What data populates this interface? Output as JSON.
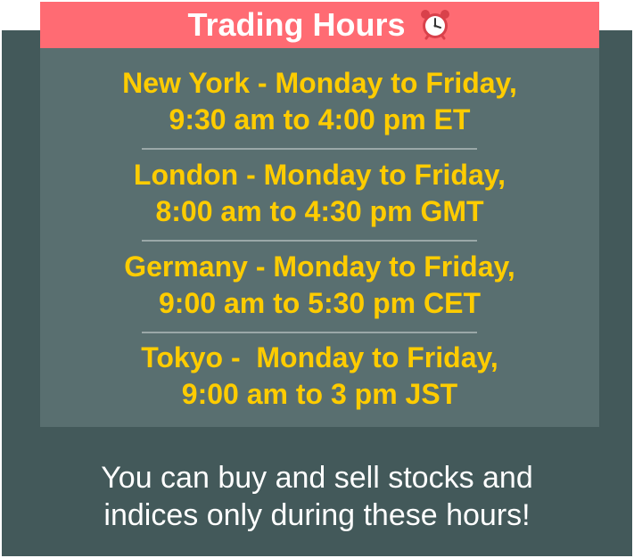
{
  "header": {
    "title": "Trading Hours",
    "icon": "alarm-clock-icon",
    "accent_color": "#ff6b73"
  },
  "markets": [
    {
      "line1": "New York - Monday to Friday,",
      "line2": "9:30 am to 4:00 pm ET"
    },
    {
      "line1": "London - Monday to Friday,",
      "line2": "8:00 am to 4:30 pm GMT"
    },
    {
      "line1": "Germany - Monday to Friday,",
      "line2": "9:00 am to 5:30 pm CET"
    },
    {
      "line1": "Tokyo -  Monday to Friday,",
      "line2": "9:00 am to 3 pm JST"
    }
  ],
  "footer": {
    "line1": "You can buy and sell stocks and",
    "line2": "indices only during these hours!"
  },
  "colors": {
    "background": "#43595a",
    "panel": "#596f70",
    "highlight_text": "#ffcc00"
  }
}
